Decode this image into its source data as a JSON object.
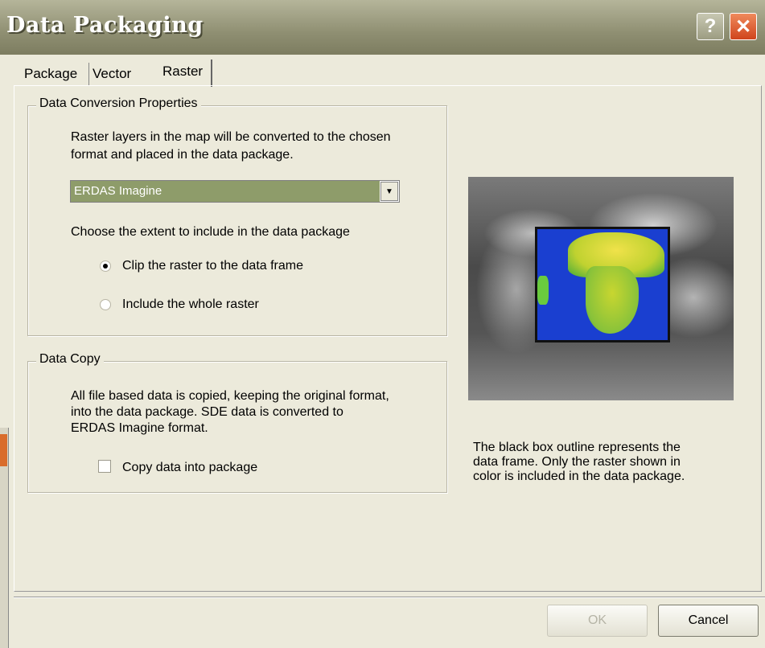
{
  "window": {
    "title": "Data Packaging",
    "help_glyph": "?",
    "close_glyph": "✕"
  },
  "tabs": [
    {
      "label": "Package",
      "active": false
    },
    {
      "label": "Vector",
      "active": false
    },
    {
      "label": "Raster",
      "active": true
    }
  ],
  "conversion": {
    "legend": "Data Conversion Properties",
    "description_line1": "Raster layers in the map will be converted to the chosen",
    "description_line2": "format and placed in the data package.",
    "format_value": "ERDAS Imagine",
    "extent_prompt": "Choose the extent  to include in the data package",
    "radio_clip": {
      "label": "Clip the raster to the data frame",
      "checked": true
    },
    "radio_whole": {
      "label": "Include the whole raster",
      "checked": false
    }
  },
  "copy": {
    "legend": "Data Copy",
    "description_line1": "All file based data is copied, keeping the original format,",
    "description_line2": "into the data package.   SDE data is converted to",
    "description_line3": "ERDAS Imagine format.",
    "checkbox_label": "Copy data into package",
    "checked": false
  },
  "preview": {
    "caption_line1": "The black box outline represents the",
    "caption_line2": "data frame.  Only the raster shown in",
    "caption_line3": "color is included in the data package."
  },
  "buttons": {
    "ok": "OK",
    "cancel": "Cancel",
    "ok_enabled": false
  },
  "colors": {
    "title_bar": "#8f8f72",
    "dropdown_selected": "#8e9c6a",
    "close_button": "#d0441c"
  }
}
